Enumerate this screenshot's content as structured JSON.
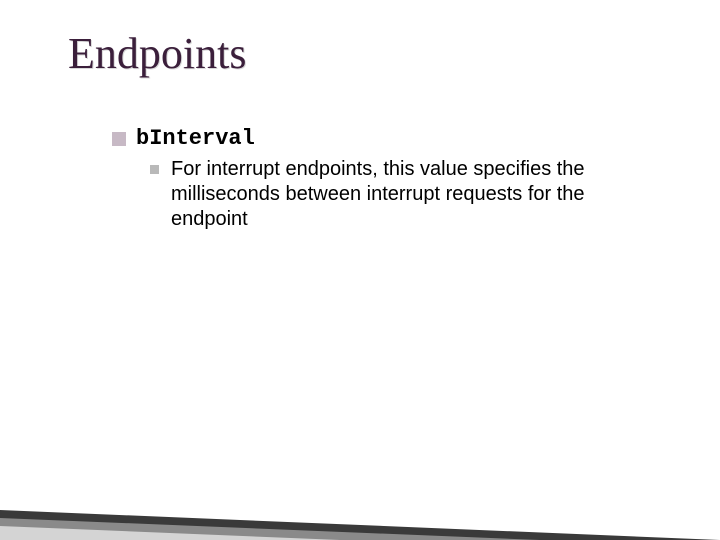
{
  "title": "Endpoints",
  "bullets": [
    {
      "label": "bInterval",
      "sub": [
        "For interrupt endpoints, this value specifies the milliseconds between interrupt requests for the endpoint"
      ]
    }
  ]
}
